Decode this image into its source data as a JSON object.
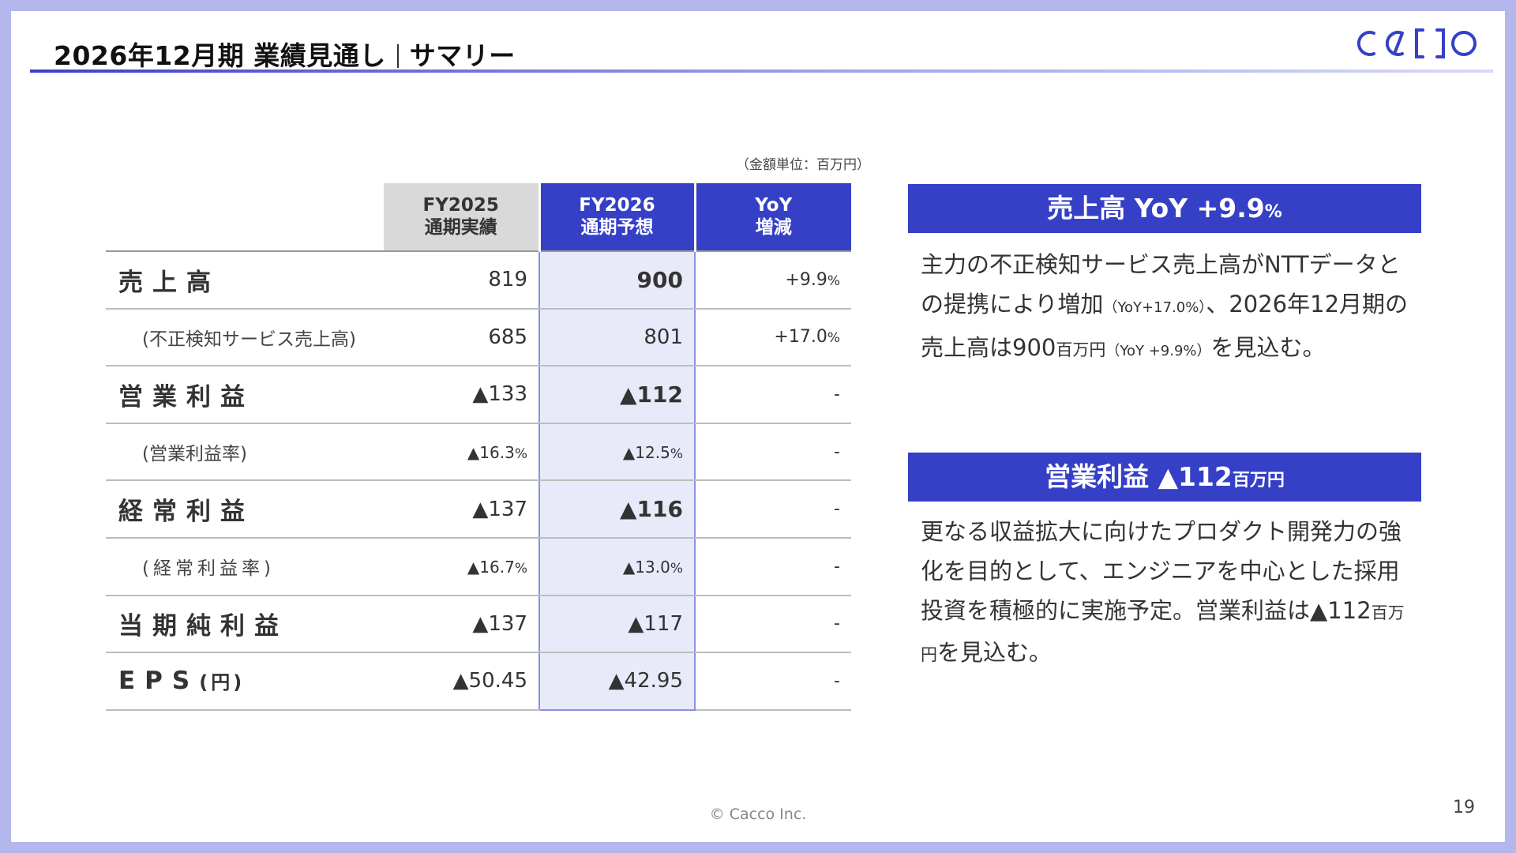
{
  "header": {
    "title_main": "2026年12月期 業績見通し",
    "title_sub": "サマリー",
    "logo_text": "cacco",
    "accent_color": "#3540c7"
  },
  "unit_note": "（金額単位：百万円）",
  "table": {
    "headers": {
      "fy2025_line1": "FY2025",
      "fy2025_line2": "通期実績",
      "fy2026_line1": "FY2026",
      "fy2026_line2": "通期予想",
      "yoy_line1": "YoY",
      "yoy_line2": "増減"
    },
    "rows": [
      {
        "label": "売上高",
        "fy2025": "819",
        "fy2026": "900",
        "yoy_num": "+9.9",
        "yoy_unit": "%"
      },
      {
        "label": "(不正検知サービス売上高)",
        "fy2025": "685",
        "fy2026": "801",
        "yoy_num": "+17.0",
        "yoy_unit": "%"
      },
      {
        "label": "営業利益",
        "fy2025": "▲133",
        "fy2026": "▲112",
        "yoy": "-"
      },
      {
        "label": "(営業利益率)",
        "fy2025_num": "▲16.3",
        "fy2025_unit": "%",
        "fy2026_num": "▲12.5",
        "fy2026_unit": "%",
        "yoy": "-"
      },
      {
        "label": "経常利益",
        "fy2025": "▲137",
        "fy2026": "▲116",
        "yoy": "-"
      },
      {
        "label": "(経常利益率)",
        "fy2025_num": "▲16.7",
        "fy2025_unit": "%",
        "fy2026_num": "▲13.0",
        "fy2026_unit": "%",
        "yoy": "-"
      },
      {
        "label": "当期純利益",
        "fy2025": "▲137",
        "fy2026": "▲117",
        "yoy": "-"
      },
      {
        "label_main": "EPS",
        "label_unit": "(円)",
        "fy2025": "▲50.45",
        "fy2026": "▲42.95",
        "yoy": "-"
      }
    ]
  },
  "cards": [
    {
      "title_main": "売上高 YoY +9.9",
      "title_unit": "%",
      "body_1": "主力の不正検知サービス売上高がNTTデータとの提携により増加",
      "body_2": "（YoY+17.0%）",
      "body_3": "、2026年12月期の売上高は900",
      "body_4": "百万円",
      "body_5": "（YoY +9.9%）",
      "body_6": "を見込む。"
    },
    {
      "title_main": "営業利益 ▲112",
      "title_unit": "百万円",
      "body_1": "更なる収益拡大に向けたプロダクト開発力の強化を目的として、エンジニアを中心とした採用投資を積極的に実施予定。営業利益は▲112",
      "body_2": "百万円",
      "body_3": "を見込む。"
    }
  ],
  "footer": {
    "copyright": "© Cacco Inc.",
    "page_number": "19"
  }
}
